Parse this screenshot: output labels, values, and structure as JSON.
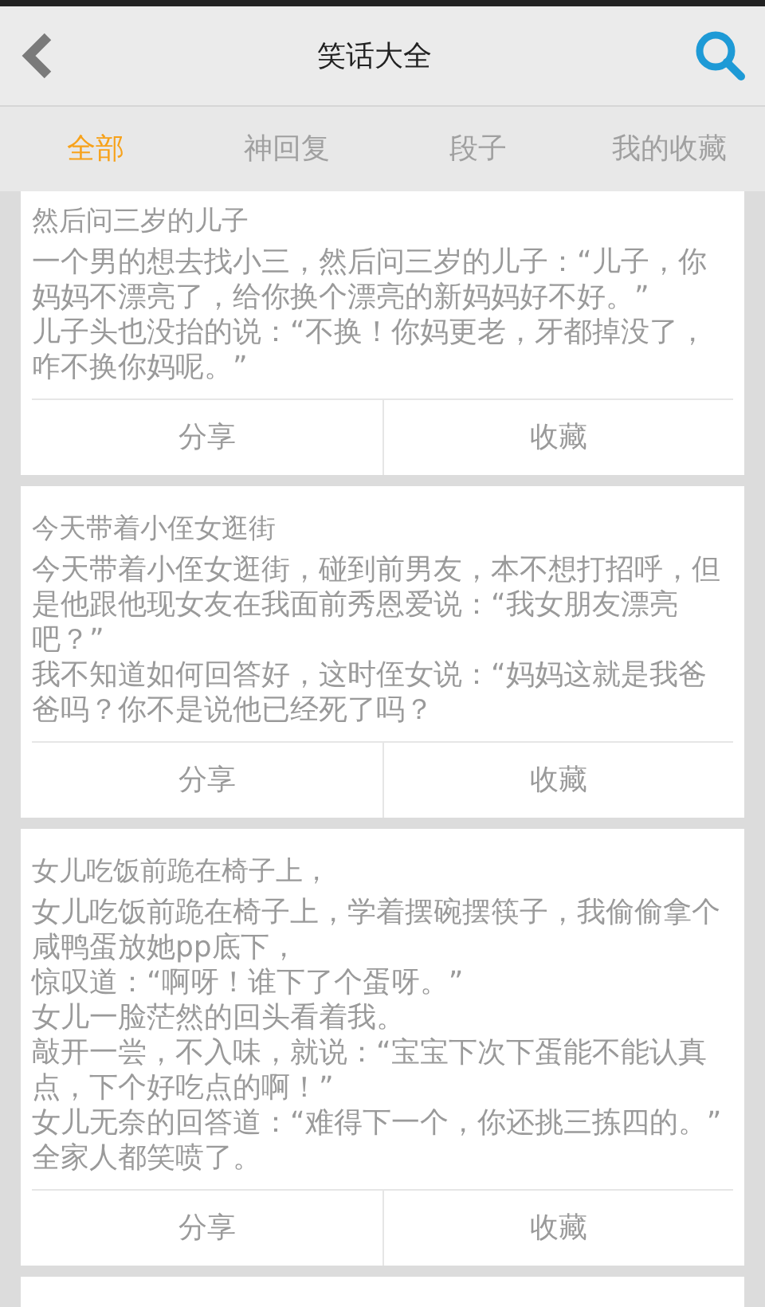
{
  "header": {
    "title": "笑话大全"
  },
  "tabs": [
    {
      "label": "全部",
      "selected": true
    },
    {
      "label": "神回复",
      "selected": false
    },
    {
      "label": "段子",
      "selected": false
    },
    {
      "label": "我的收藏",
      "selected": false
    }
  ],
  "jokes": [
    {
      "title": "然后问三岁的儿子",
      "paragraphs": [
        "一个男的想去找小三，然后问三岁的儿子：“儿子，你妈妈不漂亮了，给你换个漂亮的新妈妈好不好。”",
        "儿子头也没抬的说：“不换！你妈更老，牙都掉没了，咋不换你妈呢。”"
      ],
      "actions": [
        "分享",
        "收藏"
      ]
    },
    {
      "title": "今天带着小侄女逛街",
      "paragraphs": [
        "今天带着小侄女逛街，碰到前男友，本不想打招呼，但是他跟他现女友在我面前秀恩爱说：“我女朋友漂亮吧？”",
        "我不知道如何回答好，这时侄女说：“妈妈这就是我爸爸吗？你不是说他已经死了吗？"
      ],
      "actions": [
        "分享",
        "收藏"
      ]
    },
    {
      "title": "女儿吃饭前跪在椅子上，",
      "paragraphs": [
        "女儿吃饭前跪在椅子上，学着摆碗摆筷子，我偷偷拿个咸鸭蛋放她pp底下，",
        "惊叹道：“啊呀！谁下了个蛋呀。”",
        "女儿一脸茫然的回头看着我。",
        "敲开一尝，不入味，就说：“宝宝下次下蛋能不能认真点，下个好吃点的啊！”",
        "女儿无奈的回答道：“难得下一个，你还挑三拣四的。”",
        "全家人都笑喷了。"
      ],
      "actions": [
        "分享",
        "收藏"
      ]
    }
  ]
}
